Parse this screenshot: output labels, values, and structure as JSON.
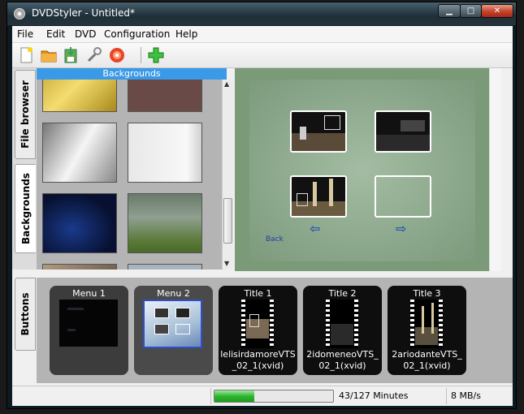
{
  "window": {
    "title": "DVDStyler - Untitled*"
  },
  "menubar": {
    "items": [
      "File",
      "Edit",
      "DVD",
      "Configuration",
      "Help"
    ]
  },
  "toolbar": {
    "tools": [
      "new-icon",
      "open-folder-icon",
      "save-icon",
      "settings-wrench-icon",
      "burn-disc-icon",
      "add-icon"
    ]
  },
  "left_panel": {
    "tabs": [
      "File browser",
      "Backgrounds"
    ],
    "active_tab": "Backgrounds",
    "header": "Backgrounds"
  },
  "preview": {
    "back_label": "Back",
    "nav_prev": "⇦",
    "nav_next": "⇨"
  },
  "bottom_panel": {
    "tab": "Buttons",
    "items": [
      {
        "label": "Menu 1",
        "kind": "menu"
      },
      {
        "label": "Menu 2",
        "kind": "menu",
        "selected": true
      },
      {
        "label": "Title 1",
        "kind": "title",
        "file": "lelisirdamoreVTS_02_1(xvid)"
      },
      {
        "label": "Title 2",
        "kind": "title",
        "file": "2idomeneoVTS_02_1(xvid)"
      },
      {
        "label": "Title 3",
        "kind": "title",
        "file": "2ariodanteVTS_02_1(xvid)"
      }
    ]
  },
  "status": {
    "progress": 0.339,
    "minutes": "43/127 Minutes",
    "rate": "8 MB/s"
  },
  "colors": {
    "accent": "#3b9ae8",
    "progress_green": "#2fb52f"
  }
}
